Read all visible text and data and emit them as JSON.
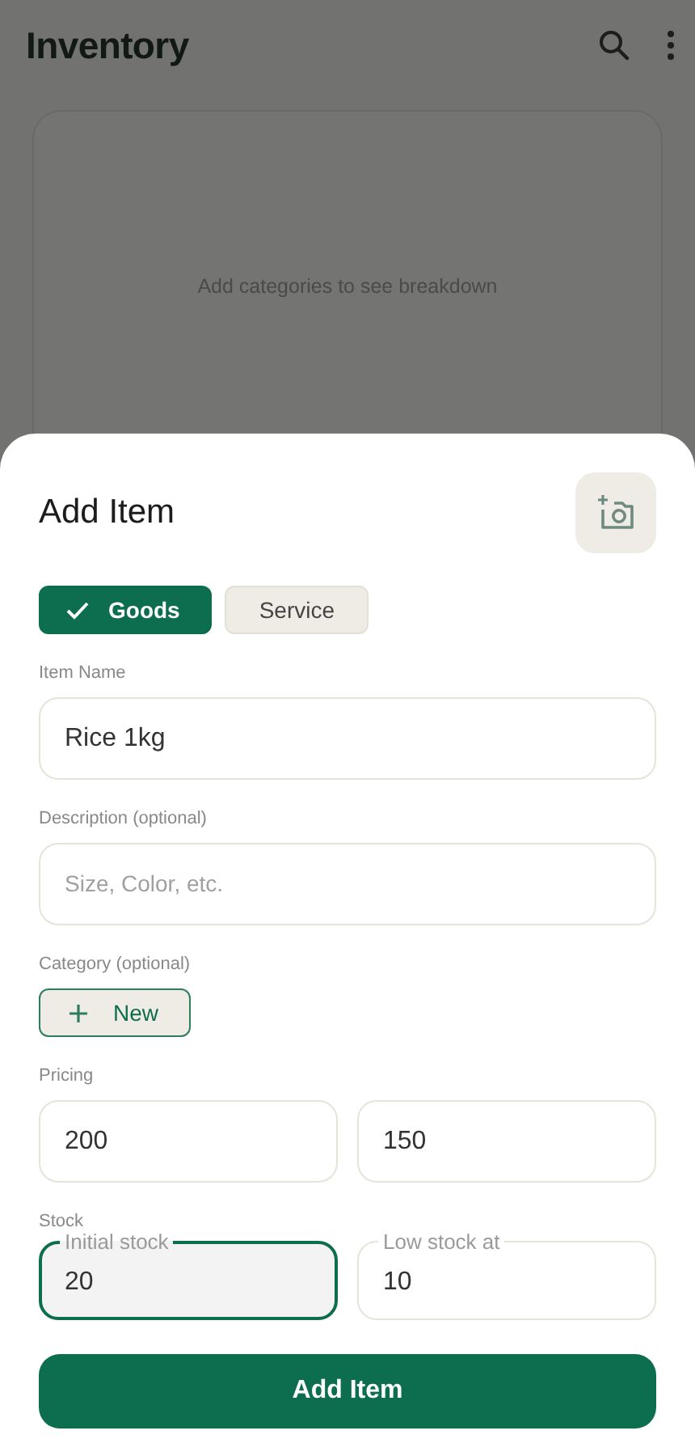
{
  "header": {
    "title": "Inventory"
  },
  "card": {
    "empty_text": "Add categories to see breakdown"
  },
  "sheet": {
    "title": "Add Item",
    "type_options": [
      {
        "label": "Goods",
        "selected": true
      },
      {
        "label": "Service",
        "selected": false
      }
    ],
    "sections": [
      {
        "label": "Item Name",
        "kind": "fields",
        "fields": [
          {
            "value": "Rice 1kg",
            "focused": false
          }
        ]
      },
      {
        "label": "Description (optional)",
        "kind": "fields",
        "fields": [
          {
            "placeholder": "Size, Color, etc.",
            "focused": false
          }
        ]
      },
      {
        "label": "Category (optional)",
        "kind": "button",
        "button": "New"
      },
      {
        "label": "Pricing",
        "kind": "fields",
        "fields": [
          {
            "value": "200",
            "focused": false
          },
          {
            "value": "150",
            "focused": false
          }
        ]
      },
      {
        "label": "Stock",
        "kind": "fields",
        "fields": [
          {
            "floating_label": "Initial stock",
            "value": "20",
            "focused": true
          },
          {
            "floating_label": "Low stock at",
            "value": "10",
            "focused": false
          }
        ]
      }
    ],
    "submit": "Add Item"
  }
}
